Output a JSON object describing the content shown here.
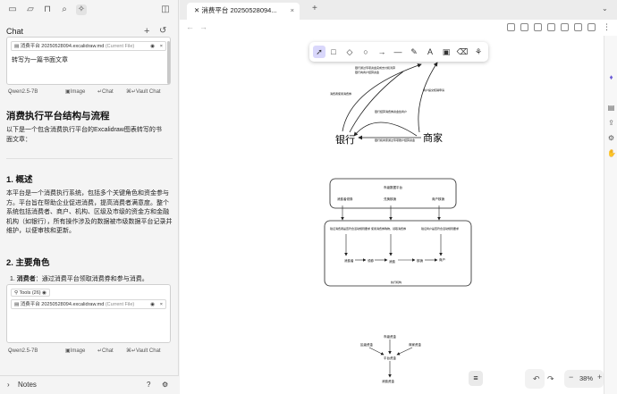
{
  "left_panel": {
    "chat_title": "Chat",
    "file_chip": {
      "name": "消费平台 20250528094",
      "ext": ".excalidraw.md",
      "current": "(Current File)"
    },
    "prompt": "转写为一篇书面文章",
    "model": "Qwen2.5-7B",
    "image_label": "Image",
    "chat_label": "Chat",
    "vault_chat_label": "Vault Chat",
    "doc": {
      "title": "消费执行平台结构与流程",
      "intro": "以下是一个包含消费执行平台的Excalidraw图表转写的书面文章：",
      "sec1_title": "1. 概述",
      "sec1_body": "本平台是一个消费执行系统，包括多个关键角色和资金参与方。平台旨在帮助企业促进消费，提高消费者满意度。整个系统包括消费者、商户、机构、区级及市级的资金方和金融机构（如银行），所有操作涉及的数据被市级数据平台记录并维护，以便审核和更新。",
      "sec2_title": "2. 主要角色",
      "sec2_item_bold": "消费者",
      "sec2_item_text": "：通过消费平台领取消费券和参与消费。"
    },
    "tools_chip": "Tools (26)",
    "notes_label": "Notes"
  },
  "tab": {
    "title": "消费平台 20250528094..."
  },
  "canvas": {
    "bank": "银行",
    "merchant": "商家",
    "platform_title": "市级数据平台",
    "consumer_coupon": "消费者领券",
    "redeem": "兑换核销",
    "merchant_redeem": "商户核销",
    "flow_consumer_note": "验证消费者是否符合活动规则要求",
    "flow_usage_note": "使用消费券购物，领取消费券",
    "flow_merchant_note": "验证商户是否符合活动规则要求",
    "consumer": "消费者",
    "use_coupon": "领券",
    "spending": "消费",
    "redeem_small": "核销",
    "merchant_small": "商户",
    "inner_title": "执行机构",
    "fund_city": "市级资金",
    "fund_district": "区级资金",
    "fund_enterprise": "商家资金",
    "fund_platform": "平台资金",
    "fund_bottom": "消费资金",
    "note_top1": "银行通过专项资金完成支付和清算",
    "note_top2": "银行向商户结算资金",
    "note_left": "消费者使用消费券",
    "note_mid": "银行结算消费券资金给商户",
    "note_right": "商户提交核销申请",
    "note_bottom": "银行和商家通过专项账户结算资金"
  },
  "zoom": "38%"
}
